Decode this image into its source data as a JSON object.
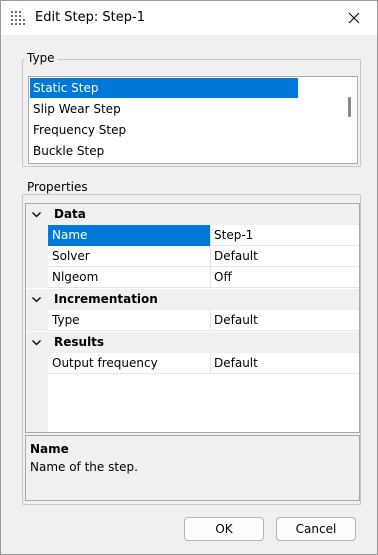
{
  "window": {
    "title": "Edit Step: Step-1"
  },
  "type_group": {
    "label": "Type",
    "items": [
      "Static Step",
      "Slip Wear Step",
      "Frequency Step",
      "Buckle Step"
    ],
    "selected_index": 0
  },
  "properties_group": {
    "label": "Properties",
    "categories": [
      {
        "name": "Data",
        "rows": [
          {
            "name": "Name",
            "value": "Step-1"
          },
          {
            "name": "Solver",
            "value": "Default"
          },
          {
            "name": "Nlgeom",
            "value": "Off"
          }
        ]
      },
      {
        "name": "Incrementation",
        "rows": [
          {
            "name": "Type",
            "value": "Default"
          }
        ]
      },
      {
        "name": "Results",
        "rows": [
          {
            "name": "Output frequency",
            "value": "Default"
          }
        ]
      }
    ]
  },
  "description": {
    "title": "Name",
    "text": "Name of the step."
  },
  "buttons": {
    "ok": "OK",
    "cancel": "Cancel"
  },
  "colors": {
    "selection": "#0078d7",
    "window_bg": "#f0f0f0"
  }
}
